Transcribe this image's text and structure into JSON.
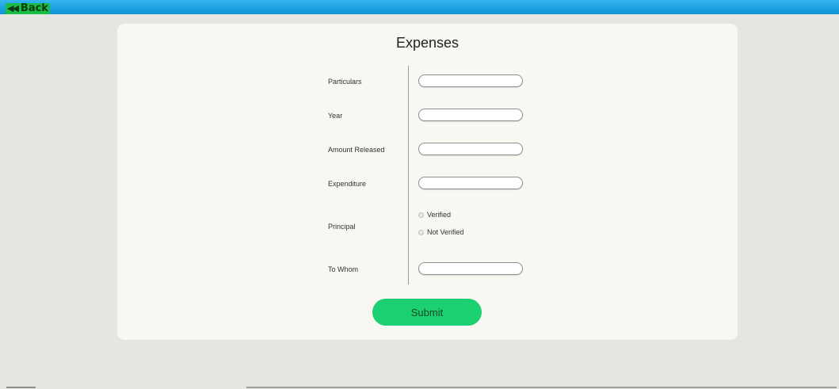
{
  "header": {
    "back_icon": "double-chevron-left-icon",
    "back_label": "Back"
  },
  "form": {
    "title": "Expenses",
    "fields": [
      {
        "label": "Particulars",
        "value": "",
        "placeholder": ""
      },
      {
        "label": "Year",
        "value": "",
        "placeholder": ""
      },
      {
        "label": "Amount Released",
        "value": "",
        "placeholder": ""
      },
      {
        "label": "Expenditure",
        "value": "",
        "placeholder": ""
      },
      {
        "label": "To Whom",
        "value": "",
        "placeholder": ""
      }
    ],
    "principal": {
      "label": "Principal",
      "options": [
        "Verified",
        "Not Verified"
      ],
      "selected": null
    },
    "submit_label": "Submit"
  },
  "colors": {
    "topbar": "#1a9fe0",
    "back_button": "#1bbd49",
    "card_background": "#f8f7f2",
    "page_background": "#e5e5e2",
    "submit_button": "#1ccf71"
  }
}
